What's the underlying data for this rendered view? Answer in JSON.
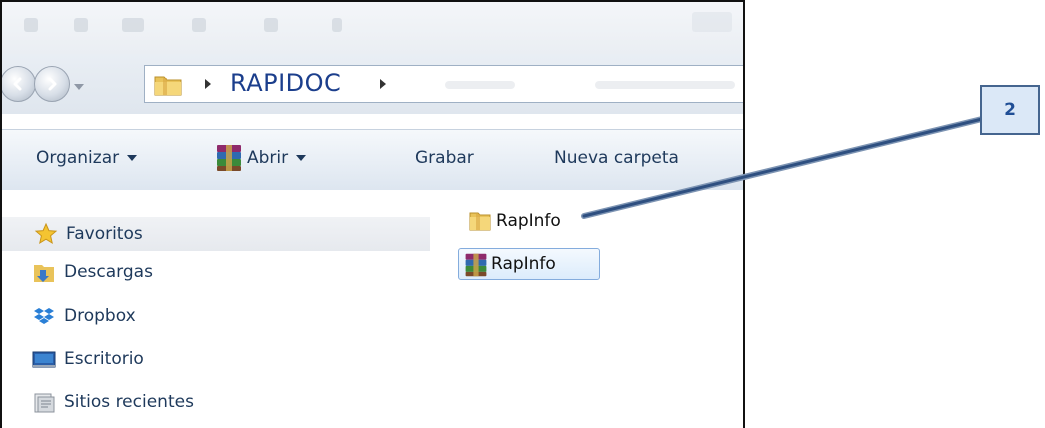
{
  "address": {
    "crumb": "RAPIDOC"
  },
  "toolbar": {
    "organize_label": "Organizar",
    "open_label": "Abrir",
    "burn_label": "Grabar",
    "new_folder_label": "Nueva carpeta"
  },
  "nav": {
    "items": [
      {
        "label": "Favoritos",
        "icon": "star-icon"
      },
      {
        "label": "Descargas",
        "icon": "downloads-icon"
      },
      {
        "label": "Dropbox",
        "icon": "dropbox-icon"
      },
      {
        "label": "Escritorio",
        "icon": "desktop-icon"
      },
      {
        "label": "Sitios recientes",
        "icon": "recent-places-icon"
      }
    ]
  },
  "files": [
    {
      "name": "RapInfo",
      "icon": "folder-icon",
      "selected": false
    },
    {
      "name": "RapInfo",
      "icon": "winrar-archive-icon",
      "selected": true
    }
  ],
  "callout": {
    "label": "2"
  },
  "colors": {
    "accent": "#1b3e8c",
    "callout_bg": "#dbe8f7",
    "callout_border": "#45658f"
  }
}
